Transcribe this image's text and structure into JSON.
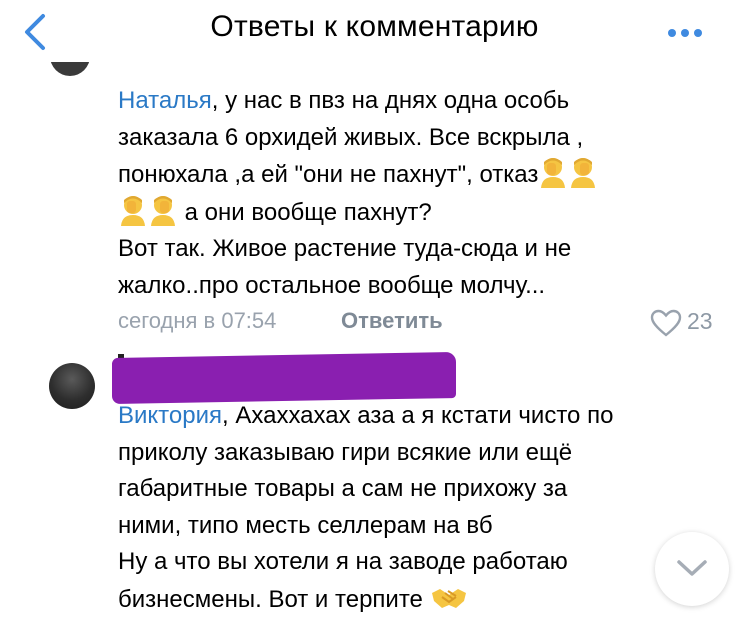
{
  "header": {
    "title": "Ответы к комментарию",
    "back_icon": "chevron-left-icon",
    "more_icon": "more-dots-icon",
    "accent_color": "#3f8ae0"
  },
  "comments": [
    {
      "mention": "Наталья",
      "text_line1_rest": ", у нас в пвз на днях одна особь",
      "text_line2": "заказала 6 орхидей живых. Все вскрыла ,",
      "text_line3": "понюхала ,а ей \"они не пахнут\", отказ",
      "text_line4_rest": " а они вообще пахнут?",
      "text_line5": "Вот так. Живое растение туда-сюда и не",
      "text_line6": "жалко..про остальное вообще молчу...",
      "emoji": "facepalm-emoji",
      "time": "сегодня в 07:54",
      "reply_label": "Ответить",
      "likes": "23",
      "like_icon": "heart-outline-icon"
    },
    {
      "author_redacted": true,
      "mention": "Виктория",
      "text_line1_rest": ", Ахаххахах аза а я кстати чисто по",
      "text_line2": "приколу заказываю гири всякие или ещё",
      "text_line3": "габаритные товары а сам не прихожу за",
      "text_line4": "ними, типо месть селлерам на вб",
      "text_line5": "Ну а что вы хотели я на заводе работаю",
      "text_line6": "бизнесмены. Вот и терпите",
      "emoji": "handshake-emoji"
    }
  ],
  "scroll_down_icon": "chevron-down-icon",
  "mention_color": "#2a79c6",
  "redaction_color": "#8a1fb0"
}
